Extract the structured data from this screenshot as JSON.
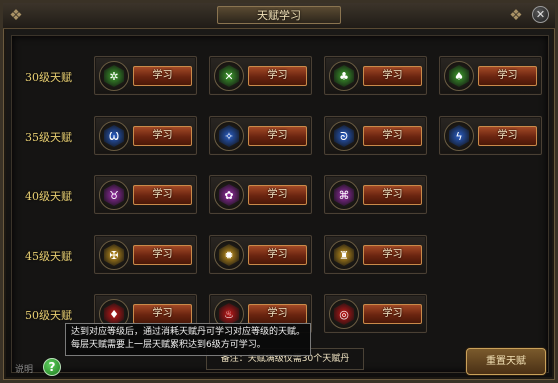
{
  "window": {
    "title": "天赋学习",
    "close_glyph": "✕",
    "corner_glyph": "❖"
  },
  "rows": [
    {
      "label": "30级天赋",
      "talents": [
        {
          "button": "学习",
          "icon": "green-leaf-talent-icon",
          "color": "#3fa02e",
          "glyph": "✲"
        },
        {
          "button": "学习",
          "icon": "green-blade-talent-icon",
          "color": "#3fa02e",
          "glyph": "✕"
        },
        {
          "button": "学习",
          "icon": "green-shield-talent-icon",
          "color": "#3fa02e",
          "glyph": "♣"
        },
        {
          "button": "学习",
          "icon": "green-tree-talent-icon",
          "color": "#3fa02e",
          "glyph": "♠"
        }
      ]
    },
    {
      "label": "35级天赋",
      "talents": [
        {
          "button": "学习",
          "icon": "blue-horns-talent-icon",
          "color": "#2a5fc8",
          "glyph": "Ѡ"
        },
        {
          "button": "学习",
          "icon": "blue-wing-talent-icon",
          "color": "#2a5fc8",
          "glyph": "✧"
        },
        {
          "button": "学习",
          "icon": "blue-swirl-talent-icon",
          "color": "#2a5fc8",
          "glyph": "ᘐ"
        },
        {
          "button": "学习",
          "icon": "blue-feather-talent-icon",
          "color": "#2a5fc8",
          "glyph": "ϟ"
        }
      ]
    },
    {
      "label": "40级天赋",
      "talents": [
        {
          "button": "学习",
          "icon": "purple-demon-talent-icon",
          "color": "#9a2ea8",
          "glyph": "♉"
        },
        {
          "button": "学习",
          "icon": "purple-beast-talent-icon",
          "color": "#9a2ea8",
          "glyph": "✿"
        },
        {
          "button": "学习",
          "icon": "purple-rune-talent-icon",
          "color": "#9a2ea8",
          "glyph": "⌘"
        }
      ]
    },
    {
      "label": "45级天赋",
      "talents": [
        {
          "button": "学习",
          "icon": "gold-cross-talent-icon",
          "color": "#c8961e",
          "glyph": "✠"
        },
        {
          "button": "学习",
          "icon": "gold-star-talent-icon",
          "color": "#c8961e",
          "glyph": "✹"
        },
        {
          "button": "学习",
          "icon": "gold-helm-talent-icon",
          "color": "#c8961e",
          "glyph": "♜"
        }
      ]
    },
    {
      "label": "50级天赋",
      "talents": [
        {
          "button": "学习",
          "icon": "red-gem-talent-icon",
          "color": "#c41818",
          "glyph": "♦"
        },
        {
          "button": "学习",
          "icon": "red-flame-talent-icon",
          "color": "#c41818",
          "glyph": "♨"
        },
        {
          "button": "学习",
          "icon": "red-ring-talent-icon",
          "color": "#c41818",
          "glyph": "◎"
        }
      ]
    }
  ],
  "tooltip": {
    "line1": "达到对应等级后，通过消耗天赋丹可学习对应等级的天赋。",
    "line2": "每层天赋需要上一层天赋累积达到6级方可学习。"
  },
  "note": "备注：天赋满级仅需30个天赋丹",
  "help": {
    "label": "说明",
    "icon_glyph": "?"
  },
  "reset_button": "重置天赋"
}
